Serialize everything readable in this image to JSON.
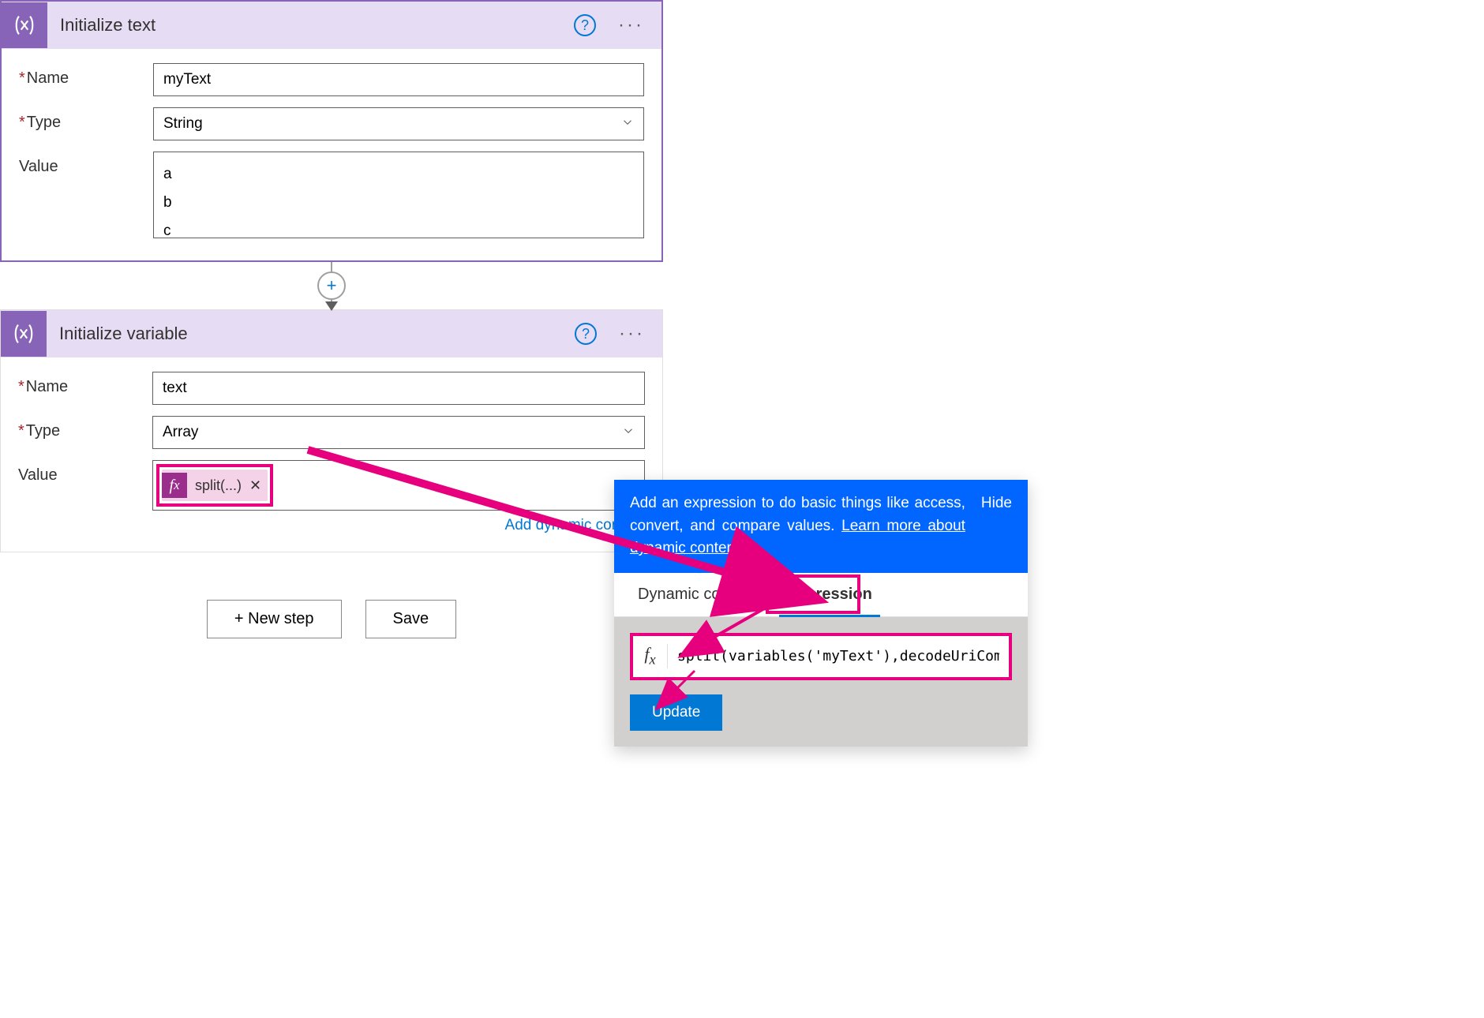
{
  "step1": {
    "title": "Initialize text",
    "name_label": "Name",
    "name_value": "myText",
    "type_label": "Type",
    "type_value": "String",
    "value_label": "Value",
    "value_text": "a\nb\nc"
  },
  "step2": {
    "title": "Initialize variable",
    "name_label": "Name",
    "name_value": "text",
    "type_label": "Type",
    "type_value": "Array",
    "value_label": "Value",
    "token_label": "split(...)",
    "add_dynamic_link": "Add dynamic content"
  },
  "footer": {
    "new_step": "+ New step",
    "save": "Save"
  },
  "popup": {
    "hint_prefix": "Add an expression to do basic things like access, convert, and compare values. ",
    "hint_link": "Learn more about dynamic content.",
    "hide": "Hide",
    "tab_dynamic": "Dynamic content",
    "tab_expression": "Expression",
    "fx_expression": "split(variables('myText'),decodeUriComponent",
    "update": "Update"
  }
}
